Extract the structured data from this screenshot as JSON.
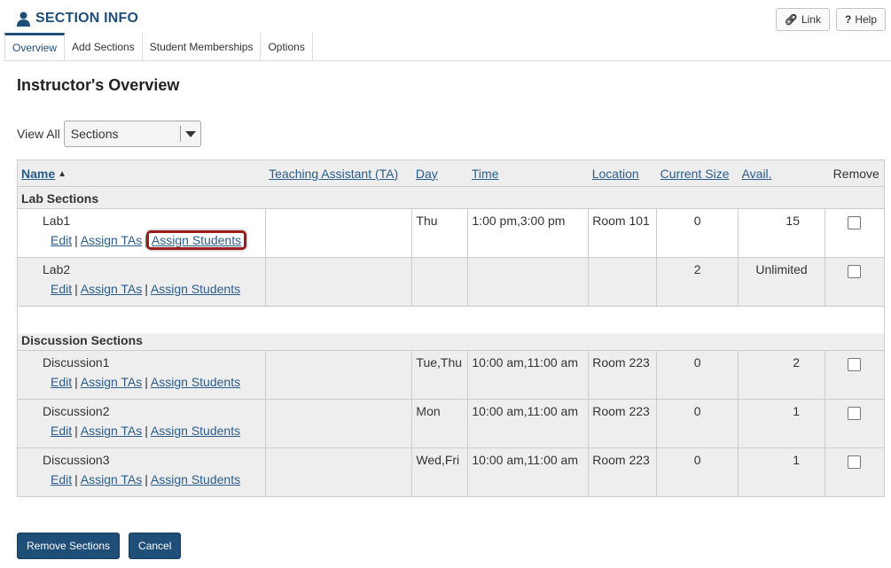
{
  "tool": {
    "title": "SECTION INFO",
    "link_label": "Link",
    "help_label": "Help"
  },
  "tabs": [
    "Overview",
    "Add Sections",
    "Student Memberships",
    "Options"
  ],
  "heading": "Instructor's Overview",
  "view": {
    "label": "View All",
    "selected": "Sections"
  },
  "columns": [
    "Name",
    "Teaching Assistant (TA)",
    "Day",
    "Time",
    "Location",
    "Current Size",
    "Avail.",
    "Remove"
  ],
  "actions_labels": {
    "edit": "Edit",
    "assign_tas": "Assign TAs",
    "assign_students": "Assign Students",
    "sep": "|"
  },
  "groups": [
    {
      "title": "Lab Sections",
      "rows": [
        {
          "name": "Lab1",
          "ta": "",
          "day": "Thu",
          "time": "1:00 pm,3:00 pm",
          "location": "Room 101",
          "size": "0",
          "avail": "15"
        },
        {
          "name": "Lab2",
          "ta": "",
          "day": "",
          "time": "",
          "location": "",
          "size": "2",
          "avail": "Unlimited"
        }
      ]
    },
    {
      "title": "Discussion Sections",
      "rows": [
        {
          "name": "Discussion1",
          "ta": "",
          "day": "Tue,Thu",
          "time": "10:00 am,11:00 am",
          "location": "Room 223",
          "size": "0",
          "avail": "2"
        },
        {
          "name": "Discussion2",
          "ta": "",
          "day": "Mon",
          "time": "10:00 am,11:00 am",
          "location": "Room 223",
          "size": "0",
          "avail": "1"
        },
        {
          "name": "Discussion3",
          "ta": "",
          "day": "Wed,Fri",
          "time": "10:00 am,11:00 am",
          "location": "Room 223",
          "size": "0",
          "avail": "1"
        }
      ]
    }
  ],
  "buttons": {
    "remove": "Remove Sections",
    "cancel": "Cancel"
  }
}
